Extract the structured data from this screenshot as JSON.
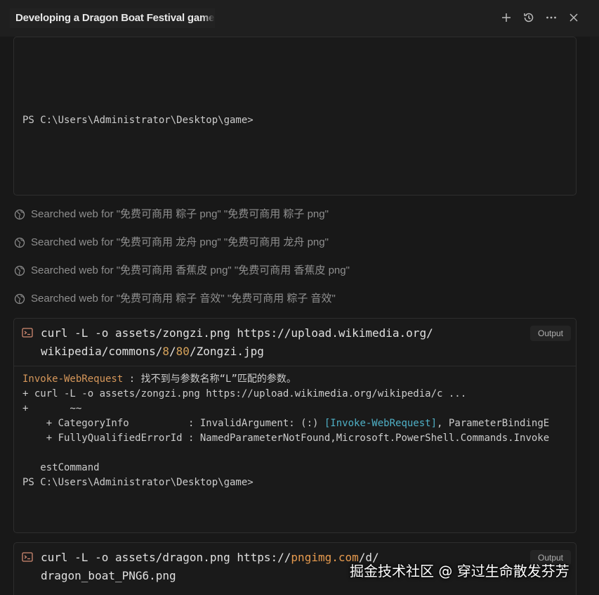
{
  "header": {
    "title": "Developing a Dragon Boat Festival game",
    "icons": [
      "plus-icon",
      "history-icon",
      "ellipsis-icon",
      "close-icon"
    ]
  },
  "terminal1": {
    "prompt": "PS C:\\Users\\Administrator\\Desktop\\game>"
  },
  "searches": [
    "Searched web for \"免费可商用 粽子 png\" \"免费可商用 粽子 png\"",
    "Searched web for \"免费可商用 龙舟 png\" \"免费可商用 龙舟 png\"",
    "Searched web for \"免费可商用 香蕉皮 png\" \"免费可商用 香蕉皮 png\"",
    "Searched web for \"免费可商用 粽子 音效\" \"免费可商用 粽子 音效\""
  ],
  "command1": {
    "line1_a": "curl -L -o assets/zongzi.png https://upload.wikimedia.org/",
    "line2_a": "wikipedia/commons/",
    "line2_num1": "8",
    "line2_slash": "/",
    "line2_num2": "80",
    "line2_b": "/Zongzi.jpg",
    "badge": "Output",
    "output": {
      "err_cmd": "Invoke-WebRequest",
      "err_msg": " : 找不到与参数名称“L”匹配的参数。",
      "line2": "+ curl -L -o assets/zongzi.png https://upload.wikimedia.org/wikipedia/c ...",
      "line3": "+       ~~",
      "line4_a": "    + CategoryInfo          : InvalidArgument: (:) ",
      "line4_b": "[Invoke-WebRequest]",
      "line4_c": ", ParameterBindingE",
      "line5": "    + FullyQualifiedErrorId : NamedParameterNotFound,Microsoft.PowerShell.Commands.Invoke",
      "line6": "   estCommand",
      "line7": "PS C:\\Users\\Administrator\\Desktop\\game>"
    }
  },
  "command2": {
    "line1_a": "curl -L -o assets/dragon.png https://",
    "line1_url": "pngimg.com",
    "line1_b": "/d/",
    "line2": "dragon_boat_PNG6.png",
    "badge": "Output"
  },
  "watermark": "掘金技术社区 @ 穿过生命散发芬芳"
}
